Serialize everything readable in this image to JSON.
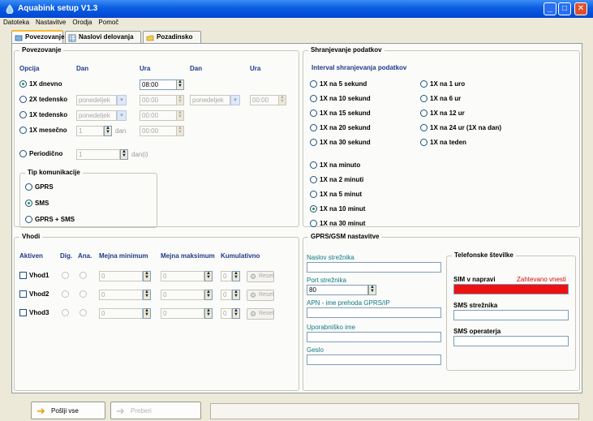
{
  "window": {
    "title": "Aquabink setup V1.3",
    "controls": {
      "minimize": "_",
      "maximize": "□",
      "close": "✕"
    }
  },
  "menu": [
    "Datoteka",
    "Nastavitve",
    "Orodja",
    "Pomoč"
  ],
  "tabs": [
    "Povezovanje",
    "Naslovi delovanja",
    "Pozadinsko"
  ],
  "schedule": {
    "group_title": "Povezovanje",
    "headers": {
      "option": "Opcija",
      "day1": "Dan",
      "time1": "Ura",
      "day2": "Dan",
      "time2": "Ura"
    },
    "daily_label": "1X dnevno",
    "daily_time": "08:00",
    "weekly2_label": "2X tedensko",
    "weekly_label": "1X tedensko",
    "monthly_label": "1X mesečno",
    "day_placeholder": "ponedeljek",
    "time_placeholder": "00:00",
    "month_day_value": "1",
    "month_unit": "dan",
    "periodic_label": "Periodično",
    "periodic_value": "1",
    "periodic_unit": "dan(i)"
  },
  "comm": {
    "group_title": "Tip komunikacije",
    "options": [
      "GPRS",
      "SMS",
      "GPRS + SMS"
    ],
    "selected": "SMS"
  },
  "storage": {
    "group_title": "Shranjevanje podatkov",
    "interval_title": "Interval shranjevanja podatkov",
    "left_options": [
      "1X na 5 sekund",
      "1X na 10 sekund",
      "1X na 15 sekund",
      "1X na 20 sekund",
      "1X na 30 sekund"
    ],
    "right_options": [
      "1X na 1 uro",
      "1X na 6 ur",
      "1X na 12 ur",
      "1X na 24 ur (1X na dan)",
      "1X na teden"
    ],
    "minute_options": [
      "1X na minuto",
      "1X na 2 minuti",
      "1X na 5 minut",
      "1X na 10 minut",
      "1X na 30 minut"
    ],
    "selected": "1X na 10 minut"
  },
  "inputs": {
    "group_title": "Vhodi",
    "headers": {
      "active": "Aktiven",
      "dig": "Dig.",
      "ana": "Ana.",
      "min": "Mejna minimum",
      "max": "Mejna maksimum",
      "cumulative": "Kumulativno"
    },
    "rows": [
      {
        "name": "Vhod1",
        "min": "0",
        "max": "0",
        "cumulative": "0",
        "button": "Reset"
      },
      {
        "name": "Vhod2",
        "min": "0",
        "max": "0",
        "cumulative": "0",
        "button": "Reset"
      },
      {
        "name": "Vhod3",
        "min": "0",
        "max": "0",
        "cumulative": "0",
        "button": "Reset"
      }
    ]
  },
  "gprs": {
    "group_title": "GPRS/GSM nastavitve",
    "server_label": "Naslov strežnika",
    "server_value": "",
    "port_label": "Port strežnika",
    "port_value": "80",
    "apn_label": "APN - ime prehoda GPRS/IP",
    "apn_value": "",
    "user_label": "Uporabniško ime",
    "user_value": "",
    "password_label": "Geslo",
    "password_value": ""
  },
  "phones": {
    "group_title": "Telefonske številke",
    "sim_label": "SIM v napravi",
    "sim_warning": "Zahtevano vnesti",
    "sim_value": "",
    "sms_server_label": "SMS strežnika",
    "sms_server_value": "",
    "sms_operator_label": "SMS operaterja",
    "sms_operator_value": ""
  },
  "footer": {
    "save_label": "Pošlji vse",
    "read_label": "Preberi",
    "status": ""
  },
  "colors": {
    "title_bar": "#0a5de0",
    "required": "#ee1111",
    "active_tab": "#f7b733"
  }
}
